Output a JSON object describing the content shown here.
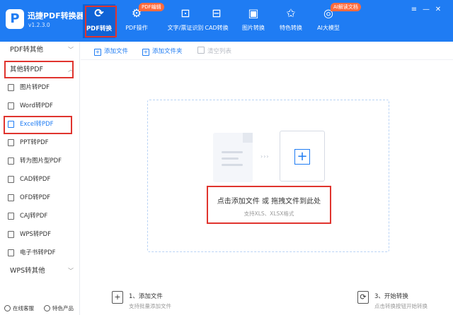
{
  "app": {
    "title": "迅捷PDF转换器",
    "version": "v1.2.3.0",
    "logo_glyph": "P"
  },
  "tabs": [
    {
      "label": "PDF转换",
      "icon": "refresh-icon",
      "glyph": "⟳"
    },
    {
      "label": "PDF操作",
      "icon": "gear-icon",
      "glyph": "⚙"
    },
    {
      "label": "文字/票证识别",
      "icon": "scan-icon",
      "glyph": "⊡"
    },
    {
      "label": "CAD转换",
      "icon": "cad-icon",
      "glyph": "⊟"
    },
    {
      "label": "图片转换",
      "icon": "image-icon",
      "glyph": "▣"
    },
    {
      "label": "特色转换",
      "icon": "star-icon",
      "glyph": "✩"
    },
    {
      "label": "AI大模型",
      "icon": "ai-icon",
      "glyph": "◎"
    }
  ],
  "badges": {
    "pdf_edit": "PDF编辑",
    "ai_doc": "AI解读文档"
  },
  "window": {
    "menu": "≡",
    "min": "—",
    "close": "✕"
  },
  "sidebar": {
    "groups": {
      "pdf_to_other": "PDF转其他",
      "other_to_pdf": "其他转PDF",
      "wps_to_other": "WPS转其他"
    },
    "items": [
      "图片转PDF",
      "Word转PDF",
      "Excel转PDF",
      "PPT转PDF",
      "转为图片型PDF",
      "CAD转PDF",
      "OFD转PDF",
      "CAJ转PDF",
      "WPS转PDF",
      "电子书转PDF"
    ],
    "selected": "Excel转PDF"
  },
  "toolbar": {
    "add_file": "添加文件",
    "add_folder": "添加文件夹",
    "clear_list": "清空列表"
  },
  "dropzone": {
    "main_text": "点击添加文件 或 拖拽文件到此处",
    "sub_text": "支持XLS、XLSX格式",
    "arrows": "›››",
    "plus": "+"
  },
  "steps": {
    "s1_title": "1、添加文件",
    "s1_sub": "支持批量添加文件",
    "s3_title": "3、开始转换",
    "s3_sub": "点击转换按钮开始转换"
  },
  "footer": {
    "online": "在线客服",
    "features": "特色产品"
  },
  "colors": {
    "brand": "#1f7cf3",
    "highlight": "#e0342e"
  }
}
